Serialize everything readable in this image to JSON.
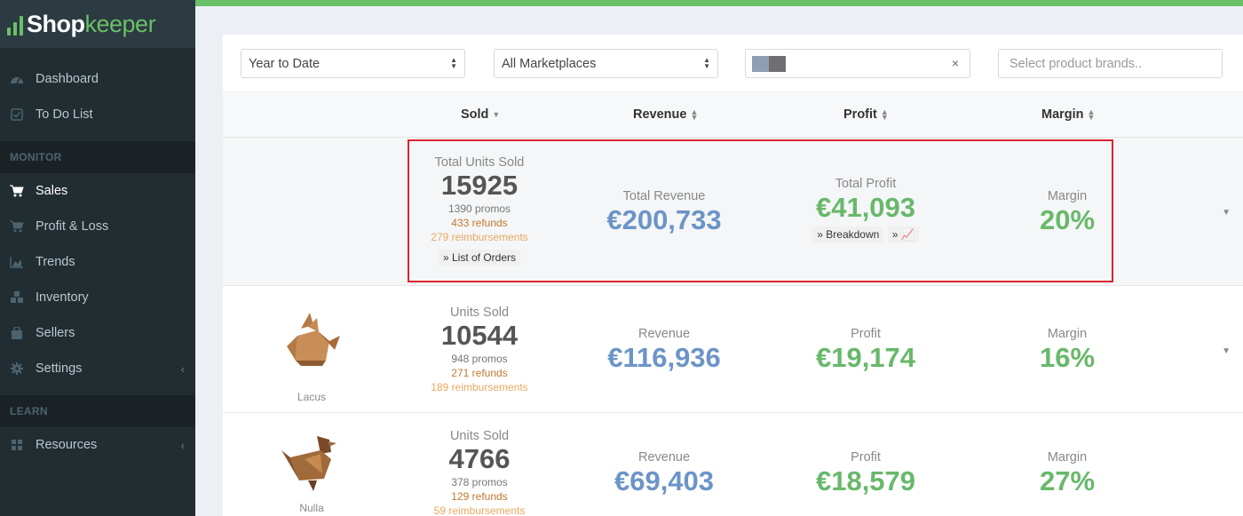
{
  "app": {
    "brand_first": "Shop",
    "brand_second": "keeper"
  },
  "colors": {
    "accent": "#6abf69",
    "sidebar_bg": "#222d32",
    "revenue": "#6b94c8",
    "profit": "#68b86a",
    "refunds": "#c07830",
    "reimbursements": "#e8a860",
    "highlight": "#d9262c"
  },
  "sidebar": {
    "items_top": [
      {
        "label": "Dashboard",
        "icon": "dashboard-icon"
      },
      {
        "label": "To Do List",
        "icon": "checkbox-icon"
      }
    ],
    "section_monitor": "MONITOR",
    "items_monitor": [
      {
        "label": "Sales",
        "icon": "cart-icon",
        "active": true
      },
      {
        "label": "Profit & Loss",
        "icon": "cart-icon"
      },
      {
        "label": "Trends",
        "icon": "area-chart-icon"
      },
      {
        "label": "Inventory",
        "icon": "cubes-icon"
      },
      {
        "label": "Sellers",
        "icon": "shopping-bag-icon"
      },
      {
        "label": "Settings",
        "icon": "gear-icon",
        "has_caret": true
      }
    ],
    "section_learn": "LEARN",
    "items_learn": [
      {
        "label": "Resources",
        "icon": "grid-icon",
        "has_caret": true
      }
    ]
  },
  "filters": {
    "period": "Year to Date",
    "marketplace": "All Marketplaces",
    "brands_placeholder": "Select product brands.."
  },
  "table": {
    "headers": {
      "sold": "Sold",
      "revenue": "Revenue",
      "profit": "Profit",
      "margin": "Margin"
    }
  },
  "totals": {
    "units_label": "Total Units Sold",
    "units": "15925",
    "promos": "1390 promos",
    "refunds": "433 refunds",
    "reimbursements": "279 reimbursements",
    "list_orders": "List of Orders",
    "revenue_label": "Total Revenue",
    "revenue": "€200,733",
    "profit_label": "Total Profit",
    "profit": "€41,093",
    "breakdown": "Breakdown",
    "margin_label": "Margin",
    "margin": "20%"
  },
  "rows": [
    {
      "product_name": "Lacus",
      "units_label": "Units Sold",
      "units": "10544",
      "promos": "948 promos",
      "refunds": "271 refunds",
      "reimbursements": "189 reimbursements",
      "revenue_label": "Revenue",
      "revenue": "€116,936",
      "profit_label": "Profit",
      "profit": "€19,174",
      "margin_label": "Margin",
      "margin": "16%"
    },
    {
      "product_name": "Nulla",
      "units_label": "Units Sold",
      "units": "4766",
      "promos": "378 promos",
      "refunds": "129 refunds",
      "reimbursements": "59 reimbursements",
      "revenue_label": "Revenue",
      "revenue": "€69,403",
      "profit_label": "Profit",
      "profit": "€18,579",
      "margin_label": "Margin",
      "margin": "27%"
    }
  ]
}
